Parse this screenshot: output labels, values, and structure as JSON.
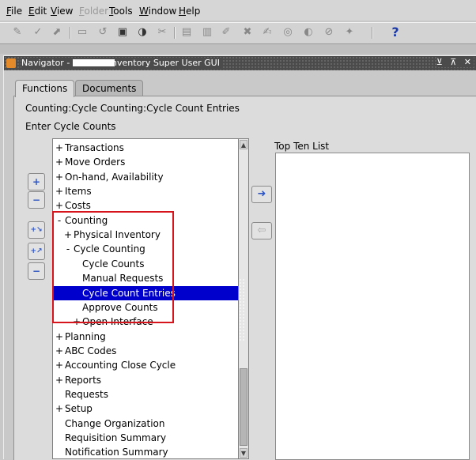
{
  "menubar": {
    "items": [
      {
        "accel": "F",
        "rest": "ile",
        "disabled": false
      },
      {
        "accel": "E",
        "rest": "dit",
        "disabled": false
      },
      {
        "accel": "V",
        "rest": "iew",
        "disabled": false
      },
      {
        "accel": "F",
        "rest": "older",
        "disabled": true
      },
      {
        "accel": "T",
        "rest": "ools",
        "disabled": false
      },
      {
        "accel": "W",
        "rest": "indow",
        "disabled": false
      },
      {
        "accel": "H",
        "rest": "elp",
        "disabled": false
      }
    ]
  },
  "toolbar": {
    "icons": [
      "new-icon",
      "find-icon",
      "navigator-icon",
      "save-icon",
      "next-step-icon",
      "print-icon",
      "close-form-icon",
      "cut-icon",
      "copy-icon",
      "paste-icon",
      "clear-record-icon",
      "delete-icon",
      "edit-field-icon",
      "zoom-icon",
      "translations-icon",
      "attachments-icon",
      "folder-tools-icon",
      "help-icon"
    ],
    "help_symbol": "?"
  },
  "window": {
    "title_prefix": "Navigator - ",
    "title_suffix": "Inventory Super User GUI",
    "controls": "⊻ ⊼ ✕"
  },
  "tabs": [
    {
      "label": "Functions",
      "active": true
    },
    {
      "label": "Documents",
      "active": false
    }
  ],
  "breadcrumb": "Counting:Cycle Counting:Cycle Count Entries",
  "enter_label": "Enter Cycle Counts",
  "side_buttons": {
    "expand": "+",
    "collapse": "−",
    "expand_branch": "+↘",
    "expand_all": "+↗",
    "collapse_all": "−"
  },
  "arrows": {
    "add": "➜",
    "remove": "⇦"
  },
  "tree": [
    {
      "toggle": "+",
      "label": "Transactions",
      "indent": 0
    },
    {
      "toggle": "+",
      "label": "Move Orders",
      "indent": 0
    },
    {
      "toggle": "+",
      "label": "On-hand, Availability",
      "indent": 0
    },
    {
      "toggle": "+",
      "label": "Items",
      "indent": 0
    },
    {
      "toggle": "+",
      "label": "Costs",
      "indent": 0
    },
    {
      "toggle": "-",
      "label": "Counting",
      "indent": 0
    },
    {
      "toggle": "+",
      "label": "Physical Inventory",
      "indent": 1
    },
    {
      "toggle": "-",
      "label": "Cycle Counting",
      "indent": 1
    },
    {
      "toggle": "",
      "label": "Cycle Counts",
      "indent": 2
    },
    {
      "toggle": "",
      "label": "Manual Requests",
      "indent": 2
    },
    {
      "toggle": "",
      "label": "Cycle Count Entries",
      "indent": 2,
      "selected": true
    },
    {
      "toggle": "",
      "label": "Approve Counts",
      "indent": 2
    },
    {
      "toggle": "+",
      "label": "Open Interface",
      "indent": 2
    },
    {
      "toggle": "+",
      "label": "Planning",
      "indent": 0
    },
    {
      "toggle": "+",
      "label": "ABC Codes",
      "indent": 0
    },
    {
      "toggle": "+",
      "label": "Accounting Close Cycle",
      "indent": 0
    },
    {
      "toggle": "+",
      "label": "Reports",
      "indent": 0
    },
    {
      "toggle": "",
      "label": "Requests",
      "indent": 0
    },
    {
      "toggle": "+",
      "label": "Setup",
      "indent": 0
    },
    {
      "toggle": "",
      "label": "Change Organization",
      "indent": 0
    },
    {
      "toggle": "",
      "label": "Requisition Summary",
      "indent": 0
    },
    {
      "toggle": "",
      "label": "Notification Summary",
      "indent": 0
    }
  ],
  "top_ten_label": "Top Ten List",
  "colors": {
    "selection": "#0000cc",
    "highlight_box": "#d6141c",
    "title_bar": "#4b4b4b"
  }
}
